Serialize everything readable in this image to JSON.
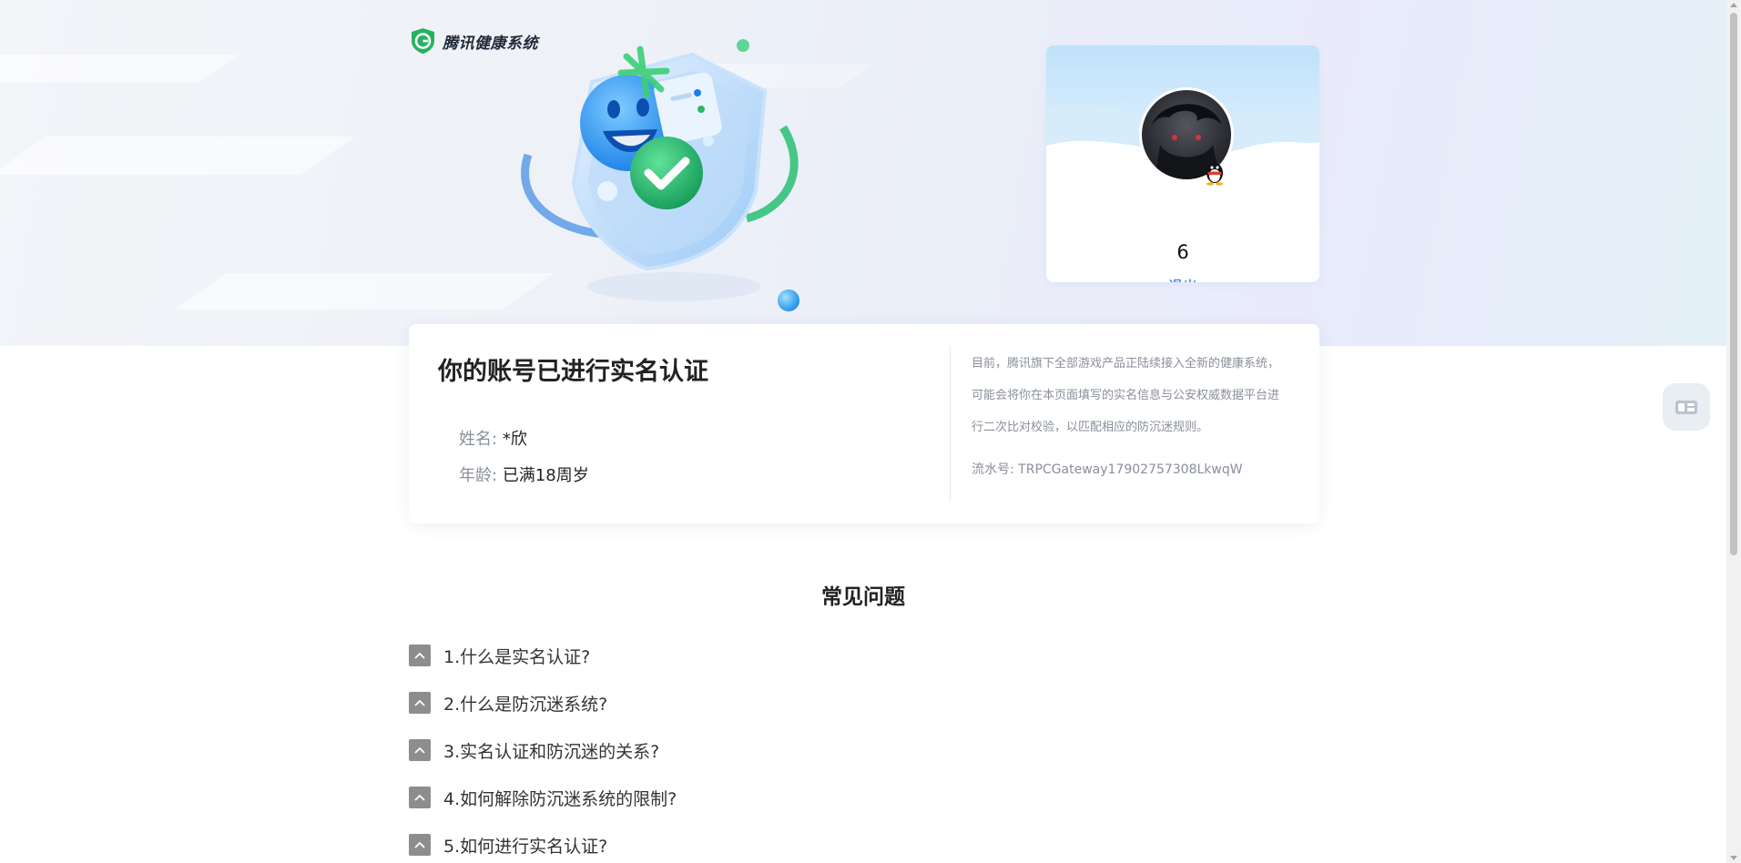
{
  "header": {
    "logo_text": "腾讯健康系统",
    "logo_icon": "tencent-health-shield-icon",
    "hero_icon": "shield-smiley-check-illustration"
  },
  "profile": {
    "username": "6",
    "logout_label": "退出",
    "avatar_icon": "user-avatar",
    "badge_icon": "qq-penguin-icon"
  },
  "verification": {
    "title": "你的账号已进行实名认证",
    "name_label": "姓名:",
    "name_value": "*欣",
    "age_label": "年龄:",
    "age_value": "已满18周岁",
    "notice_text": "目前，腾讯旗下全部游戏产品正陆续接入全新的健康系统，可能会将你在本页面填写的实名信息与公安权威数据平台进行二次比对校验，以匹配相应的防沉迷规则。",
    "serial_label": "流水号: ",
    "serial_value": "TRPCGateway17902757308LkwqW"
  },
  "faq": {
    "title": "常见问题",
    "items": [
      {
        "question": "1.什么是实名认证?"
      },
      {
        "question": "2.什么是防沉迷系统?"
      },
      {
        "question": "3.实名认证和防沉迷的关系?"
      },
      {
        "question": "4.如何解除防沉迷系统的限制?"
      },
      {
        "question": "5.如何进行实名认证?"
      }
    ]
  },
  "floating": {
    "service_icon": "customer-service-icon"
  },
  "colors": {
    "accent_link": "#1a73e8",
    "brand_green": "#2db86b",
    "toggle_gray": "#8d8d8f"
  }
}
